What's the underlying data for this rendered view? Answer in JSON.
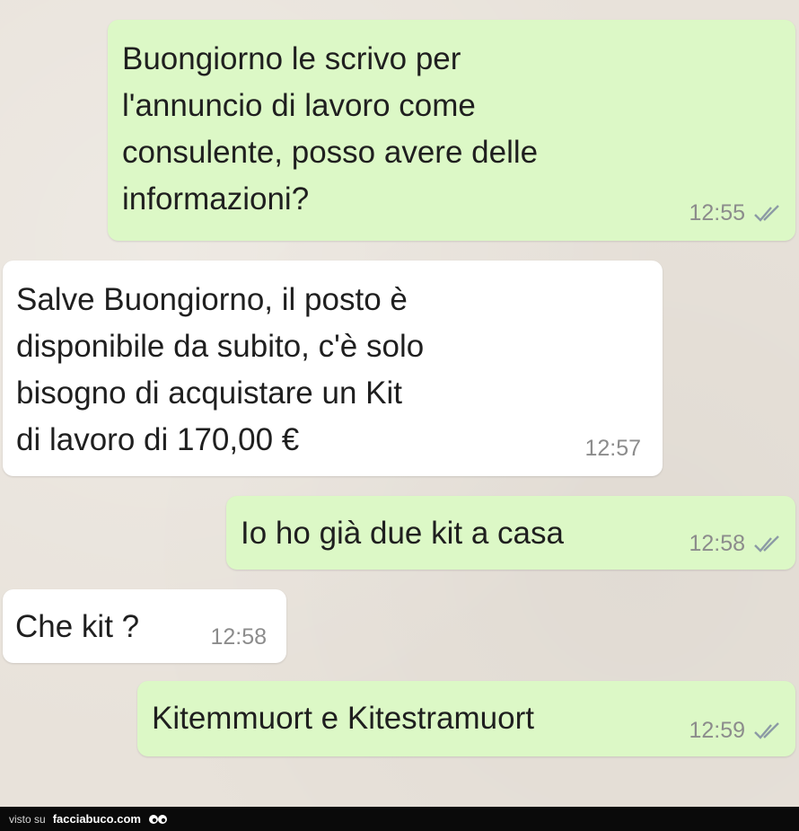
{
  "messages": [
    {
      "direction": "out",
      "text": "Buongiorno le scrivo per\nl'annuncio di lavoro come\nconsulente, posso avere delle\ninformazioni?",
      "time": "12:55",
      "status_icon": "double-check-icon"
    },
    {
      "direction": "in",
      "text": "Salve Buongiorno, il posto è\ndisponibile da subito, c'è solo\nbisogno di acquistare un Kit\ndi lavoro di 170,00 €",
      "time": "12:57"
    },
    {
      "direction": "out",
      "text": "Io ho già due kit a casa",
      "time": "12:58",
      "status_icon": "double-check-icon"
    },
    {
      "direction": "in",
      "text": "Che kit ?",
      "time": "12:58"
    },
    {
      "direction": "out",
      "text": "Kitemmuort e Kitestramuort",
      "time": "12:59",
      "status_icon": "double-check-icon"
    }
  ],
  "footer": {
    "prefix": "visto su",
    "brand": "facciabuco.com"
  },
  "colors": {
    "outgoing_bubble": "#dcf8c6",
    "incoming_bubble": "#ffffff",
    "chat_background": "#e8e2da",
    "tick_color": "#8c9aa5"
  }
}
